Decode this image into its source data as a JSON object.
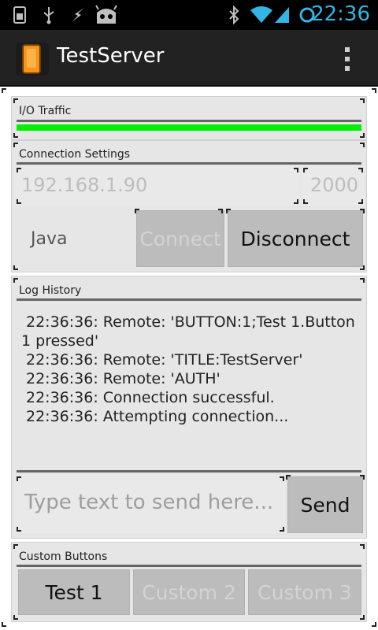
{
  "statusbar": {
    "time": "22:36",
    "icons": [
      "sim-card-icon",
      "usb-icon",
      "lightning-icon",
      "cyanogen-icon",
      "bluetooth-icon",
      "wifi-icon",
      "signal-icon",
      "battery-ring-icon"
    ]
  },
  "actionbar": {
    "title": "TestServer"
  },
  "io": {
    "label": "I/O Traffic",
    "bar_color": "#00f000"
  },
  "connection": {
    "label": "Connection Settings",
    "ip_placeholder": "192.168.1.90",
    "port_placeholder": "2000",
    "mode_label": "Java",
    "connect_label": "Connect",
    "disconnect_label": "Disconnect"
  },
  "log": {
    "label": "Log History",
    "lines": [
      "22:36:36: Remote: 'BUTTON:1;Test 1.Button",
      "1 pressed'",
      "22:36:36: Remote: 'TITLE:TestServer'",
      "22:36:36: Remote: 'AUTH'",
      "22:36:36: Connection successful.",
      "22:36:36: Attempting connection..."
    ]
  },
  "send": {
    "placeholder": "Type text to send here...",
    "button_label": "Send"
  },
  "custom": {
    "label": "Custom Buttons",
    "buttons": [
      "Test 1",
      "Custom 2",
      "Custom 3"
    ]
  }
}
